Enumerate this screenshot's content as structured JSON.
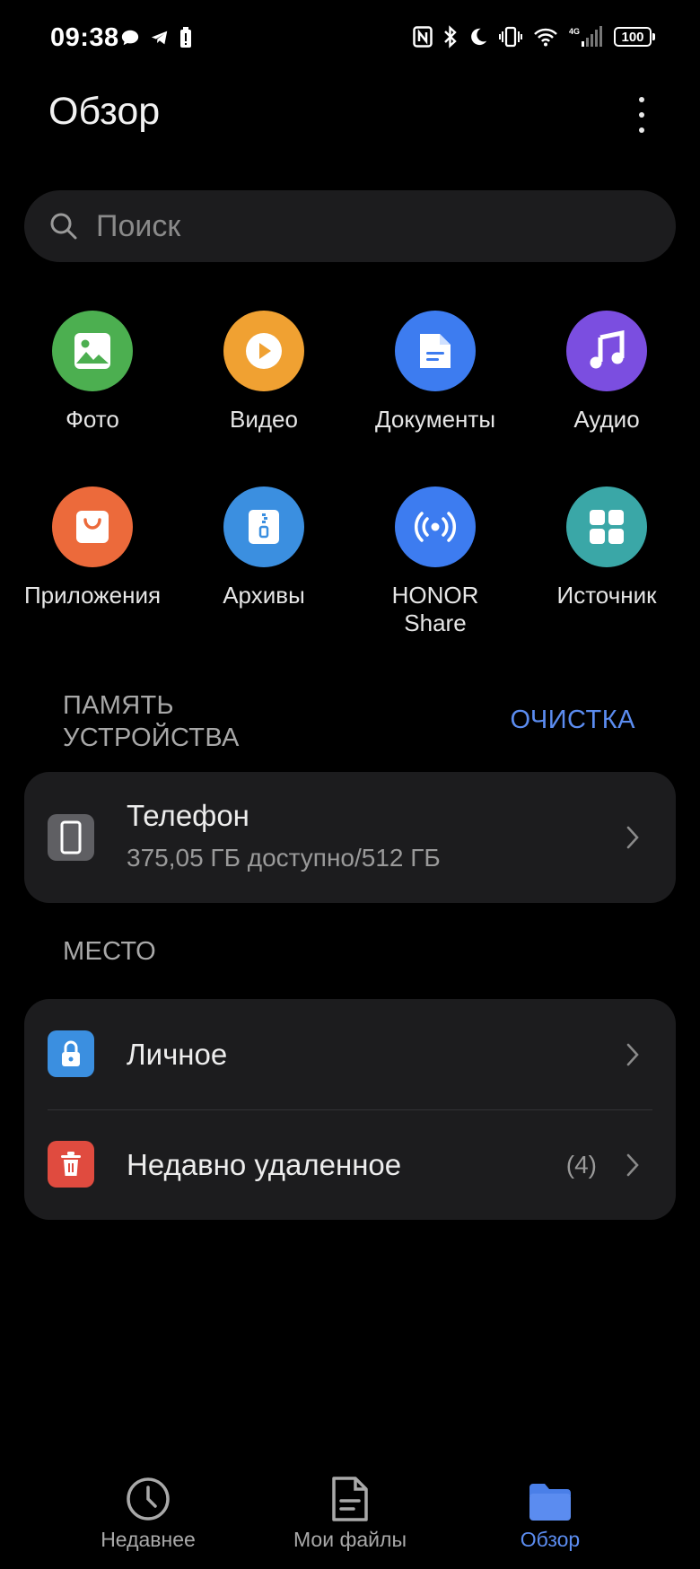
{
  "status_bar": {
    "time": "09:38",
    "battery": "100",
    "network": "4G"
  },
  "header": {
    "title": "Обзор"
  },
  "search": {
    "placeholder": "Поиск"
  },
  "categories": [
    {
      "label": "Фото",
      "icon": "photo-icon",
      "color": "#4caf50"
    },
    {
      "label": "Видео",
      "icon": "video-play-icon",
      "color": "#f0a132"
    },
    {
      "label": "Документы",
      "icon": "document-icon",
      "color": "#3d7cf0"
    },
    {
      "label": "Аудио",
      "icon": "music-note-icon",
      "color": "#7b4ee0"
    },
    {
      "label": "Приложения",
      "icon": "shopping-bag-icon",
      "color": "#ec6a3b"
    },
    {
      "label": "Архивы",
      "icon": "archive-zip-icon",
      "color": "#3b8fe0"
    },
    {
      "label": "HONOR Share",
      "icon": "broadcast-icon",
      "color": "#3d7cf0"
    },
    {
      "label": "Источник",
      "icon": "grid-apps-icon",
      "color": "#3aa7a7"
    }
  ],
  "storage": {
    "section_label": "ПАМЯТЬ УСТРОЙСТВА",
    "clean_label": "ОЧИСТКА",
    "phone": {
      "title": "Телефон",
      "subtitle": "375,05 ГБ доступно/512 ГБ"
    }
  },
  "places": {
    "section_label": "МЕСТО",
    "items": [
      {
        "title": "Личное",
        "icon": "lock-icon",
        "color": "#3b8fe0",
        "count": ""
      },
      {
        "title": "Недавно удаленное",
        "icon": "trash-icon",
        "color": "#e04b3f",
        "count": "(4)"
      }
    ]
  },
  "bottom_nav": {
    "items": [
      {
        "label": "Недавнее",
        "icon": "clock-icon",
        "active": false
      },
      {
        "label": "Мои файлы",
        "icon": "file-icon",
        "active": false
      },
      {
        "label": "Обзор",
        "icon": "folder-icon",
        "active": true
      }
    ],
    "active_color": "#5b8cf0"
  }
}
